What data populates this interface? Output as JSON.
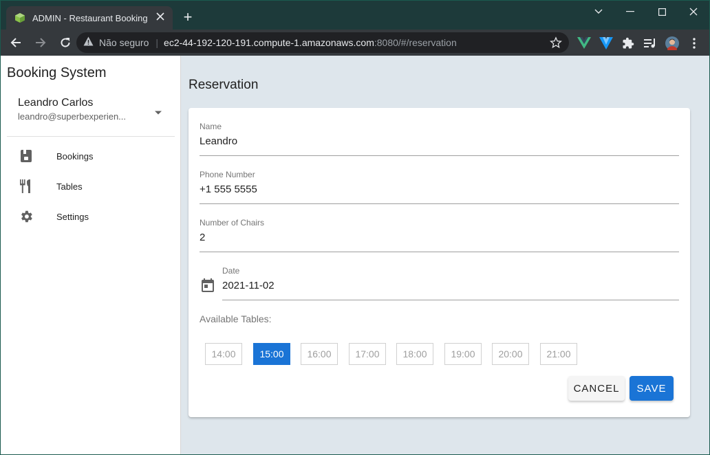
{
  "browser": {
    "tab_title": "ADMIN - Restaurant Booking",
    "new_tab_symbol": "+",
    "security_label": "Não seguro",
    "url_host": "ec2-44-192-120-191.compute-1.amazonaws.com",
    "url_rest": ":8080/#/reservation",
    "extensions": [
      "vue-devtools-icon",
      "vuetify-icon",
      "puzzle-icon",
      "media-queue-icon",
      "profile-avatar"
    ]
  },
  "sidebar": {
    "brand": "Booking System",
    "user_name": "Leandro Carlos",
    "user_email": "leandro@superbexperien...",
    "items": [
      {
        "label": "Bookings",
        "icon": "bookings-icon"
      },
      {
        "label": "Tables",
        "icon": "utensils-icon"
      },
      {
        "label": "Settings",
        "icon": "gear-icon"
      }
    ]
  },
  "main": {
    "title": "Reservation",
    "name_label": "Name",
    "name_value": "Leandro",
    "phone_label": "Phone Number",
    "phone_value": "+1 555 5555",
    "chairs_label": "Number of Chairs",
    "chairs_value": "2",
    "date_label": "Date",
    "date_value": "2021-11-02",
    "available_label": "Available Tables:",
    "slots": [
      "14:00",
      "15:00",
      "16:00",
      "17:00",
      "18:00",
      "19:00",
      "20:00",
      "21:00"
    ],
    "selected_slot": "15:00",
    "cancel_label": "CANCEL",
    "save_label": "SAVE"
  },
  "colors": {
    "primary": "#1a74d6",
    "app_background": "#dee6ec",
    "titlebar": "#1d3a3a"
  }
}
